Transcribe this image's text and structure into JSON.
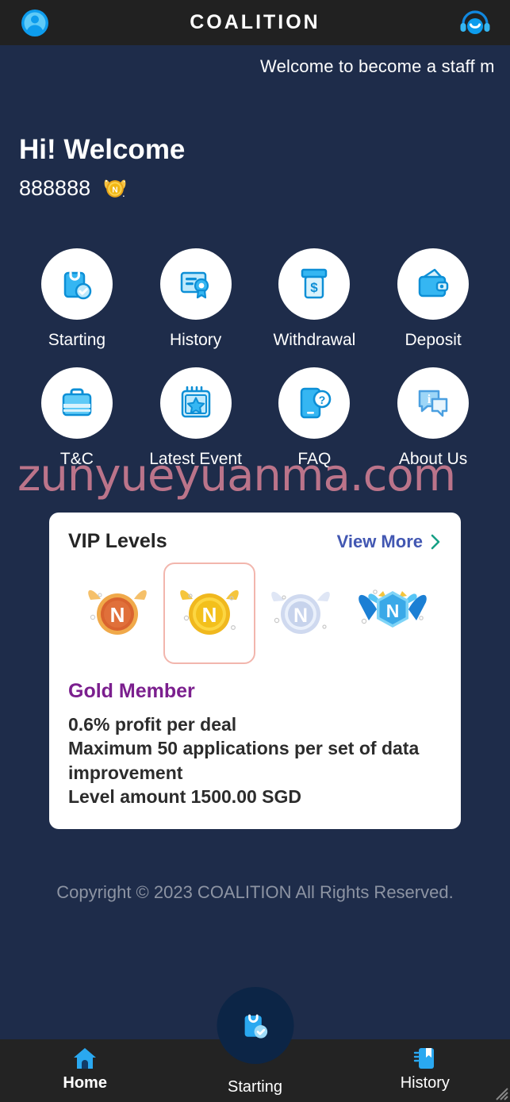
{
  "header": {
    "title": "COALITION",
    "profile_icon": "user-avatar-icon",
    "support_icon": "headset-support-icon"
  },
  "marquee": {
    "text": "Welcome to become a staff m"
  },
  "greeting": {
    "title": "Hi! Welcome",
    "username": "888888",
    "badge_icon": "gold-coin-n-badge"
  },
  "menu": {
    "items": [
      {
        "label": "Starting",
        "icon": "shopping-bag-check-icon"
      },
      {
        "label": "History",
        "icon": "certificate-icon"
      },
      {
        "label": "Withdrawal",
        "icon": "atm-dollar-icon"
      },
      {
        "label": "Deposit",
        "icon": "wallet-icon"
      },
      {
        "label": "T&C",
        "icon": "briefcase-icon"
      },
      {
        "label": "Latest Event",
        "icon": "calendar-star-icon"
      },
      {
        "label": "FAQ",
        "icon": "phone-question-icon"
      },
      {
        "label": "About Us",
        "icon": "chat-info-icon"
      }
    ]
  },
  "watermark": {
    "text": "zunyueyuanma.com"
  },
  "vip": {
    "title": "VIP Levels",
    "view_more_label": "View More",
    "view_more_icon": "chevron-right-icon",
    "levels": [
      {
        "name": "bronze-member-badge",
        "selected": false
      },
      {
        "name": "gold-member-badge",
        "selected": true
      },
      {
        "name": "silver-member-badge",
        "selected": false
      },
      {
        "name": "diamond-member-badge",
        "selected": false
      }
    ],
    "level_name": "Gold Member",
    "desc_line1": "0.6% profit per deal",
    "desc_line2": "Maximum 50 applications per set of data improvement",
    "desc_line3": "Level amount 1500.00 SGD"
  },
  "footer": {
    "copyright": "Copyright © 2023 COALITION All Rights Reserved."
  },
  "bottom_nav": {
    "items": [
      {
        "label": "Home",
        "icon": "home-icon",
        "active": true
      },
      {
        "label": "Starting",
        "icon": "shopping-bag-check-icon",
        "active": false
      },
      {
        "label": "History",
        "icon": "bookmark-book-icon",
        "active": false
      }
    ]
  },
  "colors": {
    "background": "#1e2c4a",
    "topbar": "#212121",
    "bottombar": "#232323",
    "accent_blue": "#0d9ced",
    "vip_name": "#7b1f8e",
    "view_more": "#4257b2",
    "chevron": "#16a085",
    "selected_border": "#f2b6ad",
    "watermark": "#e8899c",
    "copyright": "#8d94a3",
    "fab": "#0c2546"
  }
}
